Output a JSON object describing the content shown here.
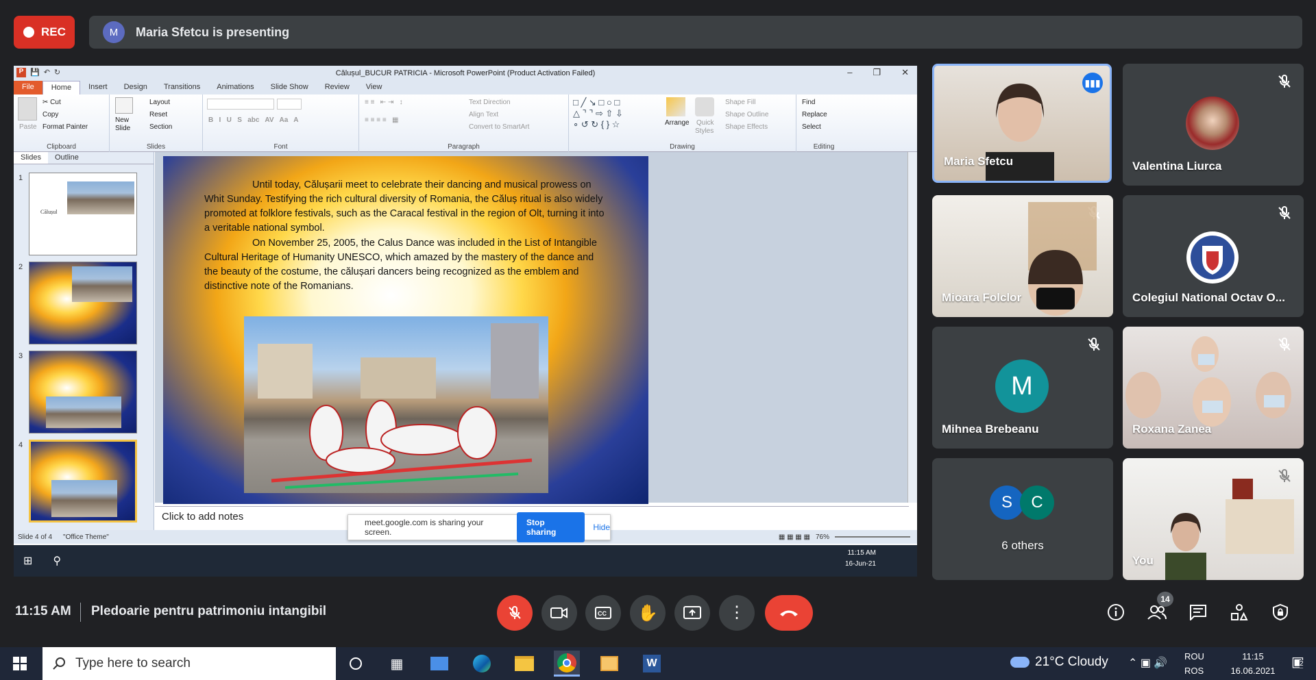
{
  "meet": {
    "rec_label": "REC",
    "presenter_initial": "M",
    "presenting_text": "Maria Sfetcu is presenting",
    "time": "11:15 AM",
    "meeting_title": "Pledoarie pentru patrimoniu intangibil",
    "participants_count": "14"
  },
  "ppt": {
    "window_title": "Călușul_BUCUR PATRICIA  -  Microsoft PowerPoint (Product Activation Failed)",
    "tabs": [
      "File",
      "Home",
      "Insert",
      "Design",
      "Transitions",
      "Animations",
      "Slide Show",
      "Review",
      "View"
    ],
    "clipboard": {
      "paste": "Paste",
      "cut": "Cut",
      "copy": "Copy",
      "format_painter": "Format Painter",
      "label": "Clipboard"
    },
    "slides_group": {
      "new_slide_1": "New",
      "new_slide_2": "Slide",
      "layout": "Layout",
      "reset": "Reset",
      "section": "Section",
      "label": "Slides"
    },
    "font_label": "Font",
    "paragraph": {
      "text_direction": "Text Direction",
      "align_text": "Align Text",
      "convert_smartart": "Convert to SmartArt",
      "label": "Paragraph"
    },
    "drawing": {
      "arrange": "Arrange",
      "quick_1": "Quick",
      "quick_2": "Styles",
      "shape_fill": "Shape Fill",
      "shape_outline": "Shape Outline",
      "shape_effects": "Shape Effects",
      "label": "Drawing"
    },
    "editing": {
      "find": "Find",
      "replace": "Replace",
      "select": "Select",
      "label": "Editing"
    },
    "pane_tabs": [
      "Slides",
      "Outline"
    ],
    "thumb_numbers": [
      "1",
      "2",
      "3",
      "4"
    ],
    "thumb1_title": "Călușul",
    "slide_paragraphs": [
      "Until today, Călușarii meet to celebrate their dancing and musical prowess on Whit Sunday. Testifying the rich cultural diversity of Romania, the Căluș ritual is also widely promoted at folklore festivals, such as the Caracal festival in the region of Olt, turning it into a veritable national symbol.",
      "On November 25, 2005, the Calus Dance was included in the List of Intangible Cultural Heritage of Humanity UNESCO, which amazed by the mastery of the dance and the beauty of the costume, the călușari dancers being recognized as the emblem and distinctive note of the Romanians."
    ],
    "notes_placeholder": "Click to add notes",
    "status_slide": "Slide 4 of 4",
    "status_theme": "\"Office Theme\"",
    "zoom": "76%",
    "share_notice": "meet.google.com is sharing your screen.",
    "stop_sharing": "Stop sharing",
    "hide": "Hide",
    "inner_time": "11:15 AM",
    "inner_date": "16-Jun-21"
  },
  "tiles": [
    {
      "name": "Maria Sfetcu",
      "speaking": true
    },
    {
      "name": "Valentina Liurca"
    },
    {
      "name": "Mioara Folclor"
    },
    {
      "name": "Colegiul National Octav O..."
    },
    {
      "name": "Mihnea Brebeanu",
      "initial": "M"
    },
    {
      "name": "Roxana Zanea"
    },
    {
      "name": "6 others",
      "initials": [
        "S",
        "C"
      ]
    },
    {
      "name": "You"
    }
  ],
  "taskbar": {
    "search_placeholder": "Type here to search",
    "weather": "21°C  Cloudy",
    "lang1": "ROU",
    "lang2": "ROS",
    "time": "11:15",
    "date": "16.06.2021",
    "notif_count": "2"
  },
  "colors": {
    "red": "#d93025",
    "meet_bg": "#202124",
    "tile": "#3c4043",
    "teal": "#12939a",
    "blue": "#1a73e8",
    "speaking": "#8ab4f8"
  }
}
